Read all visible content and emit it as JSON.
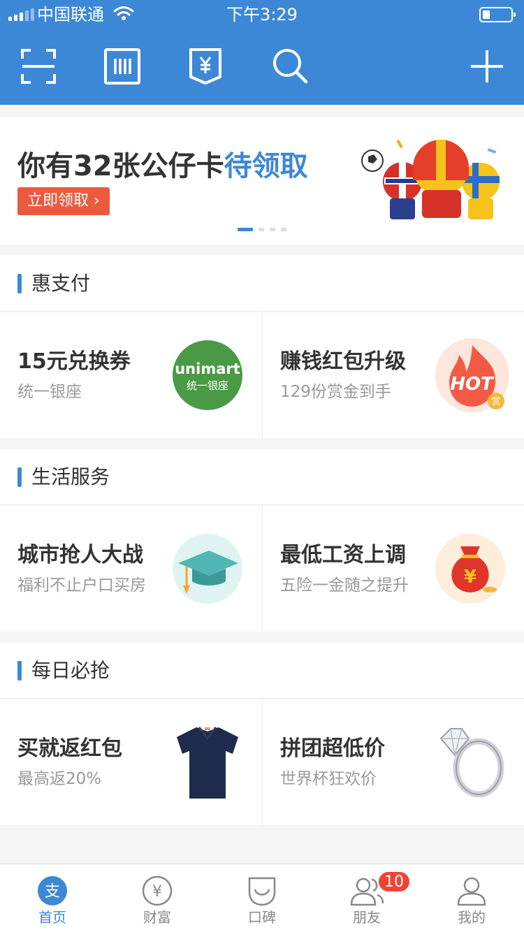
{
  "status_bar": {
    "carrier": "中国联通",
    "time": "下午3:29"
  },
  "toolbar": {
    "icons": [
      "scan-icon",
      "barcode-icon",
      "receive-money-icon",
      "search-icon",
      "add-icon"
    ]
  },
  "banner": {
    "title_prefix": "你有32张公仔卡",
    "title_highlight": "待领取",
    "cta_label": "立即领取 ›",
    "page_count": 4,
    "active_page": 1
  },
  "sections": [
    {
      "title": "惠支付",
      "cards": [
        {
          "title": "15元兑换券",
          "subtitle": "统一银座",
          "image": "unimart-logo",
          "logo_text_top": "unimart",
          "logo_text_bottom": "统一银座"
        },
        {
          "title": "赚钱红包升级",
          "subtitle": "129份赏金到手",
          "image": "hot-flame-icon",
          "logo_text_top": "HOT",
          "logo_text_bottom": "赏"
        }
      ]
    },
    {
      "title": "生活服务",
      "cards": [
        {
          "title": "城市抢人大战",
          "subtitle": "福利不止户口买房",
          "image": "graduation-cap-icon"
        },
        {
          "title": "最低工资上调",
          "subtitle": "五险一金随之提升",
          "image": "money-bag-icon",
          "logo_text_top": "¥"
        }
      ]
    },
    {
      "title": "每日必抢",
      "cards": [
        {
          "title": "买就返红包",
          "subtitle": "最高返20%",
          "image": "polo-shirt-image"
        },
        {
          "title": "拼团超低价",
          "subtitle": "世界杯狂欢价",
          "image": "diamond-ring-image"
        }
      ]
    }
  ],
  "tabbar": {
    "tabs": [
      {
        "label": "首页",
        "icon": "alipay-icon",
        "active": true,
        "glyph": "支"
      },
      {
        "label": "财富",
        "icon": "wealth-icon",
        "active": false,
        "glyph": "¥"
      },
      {
        "label": "口碑",
        "icon": "koubei-icon",
        "active": false
      },
      {
        "label": "朋友",
        "icon": "friends-icon",
        "active": false
      },
      {
        "label": "我的",
        "icon": "profile-icon",
        "active": false
      }
    ],
    "friends_badge": "10"
  },
  "colors": {
    "brand_blue": "#3d88d6",
    "cta_red": "#ec5a3e",
    "badge_red": "#f04336"
  }
}
